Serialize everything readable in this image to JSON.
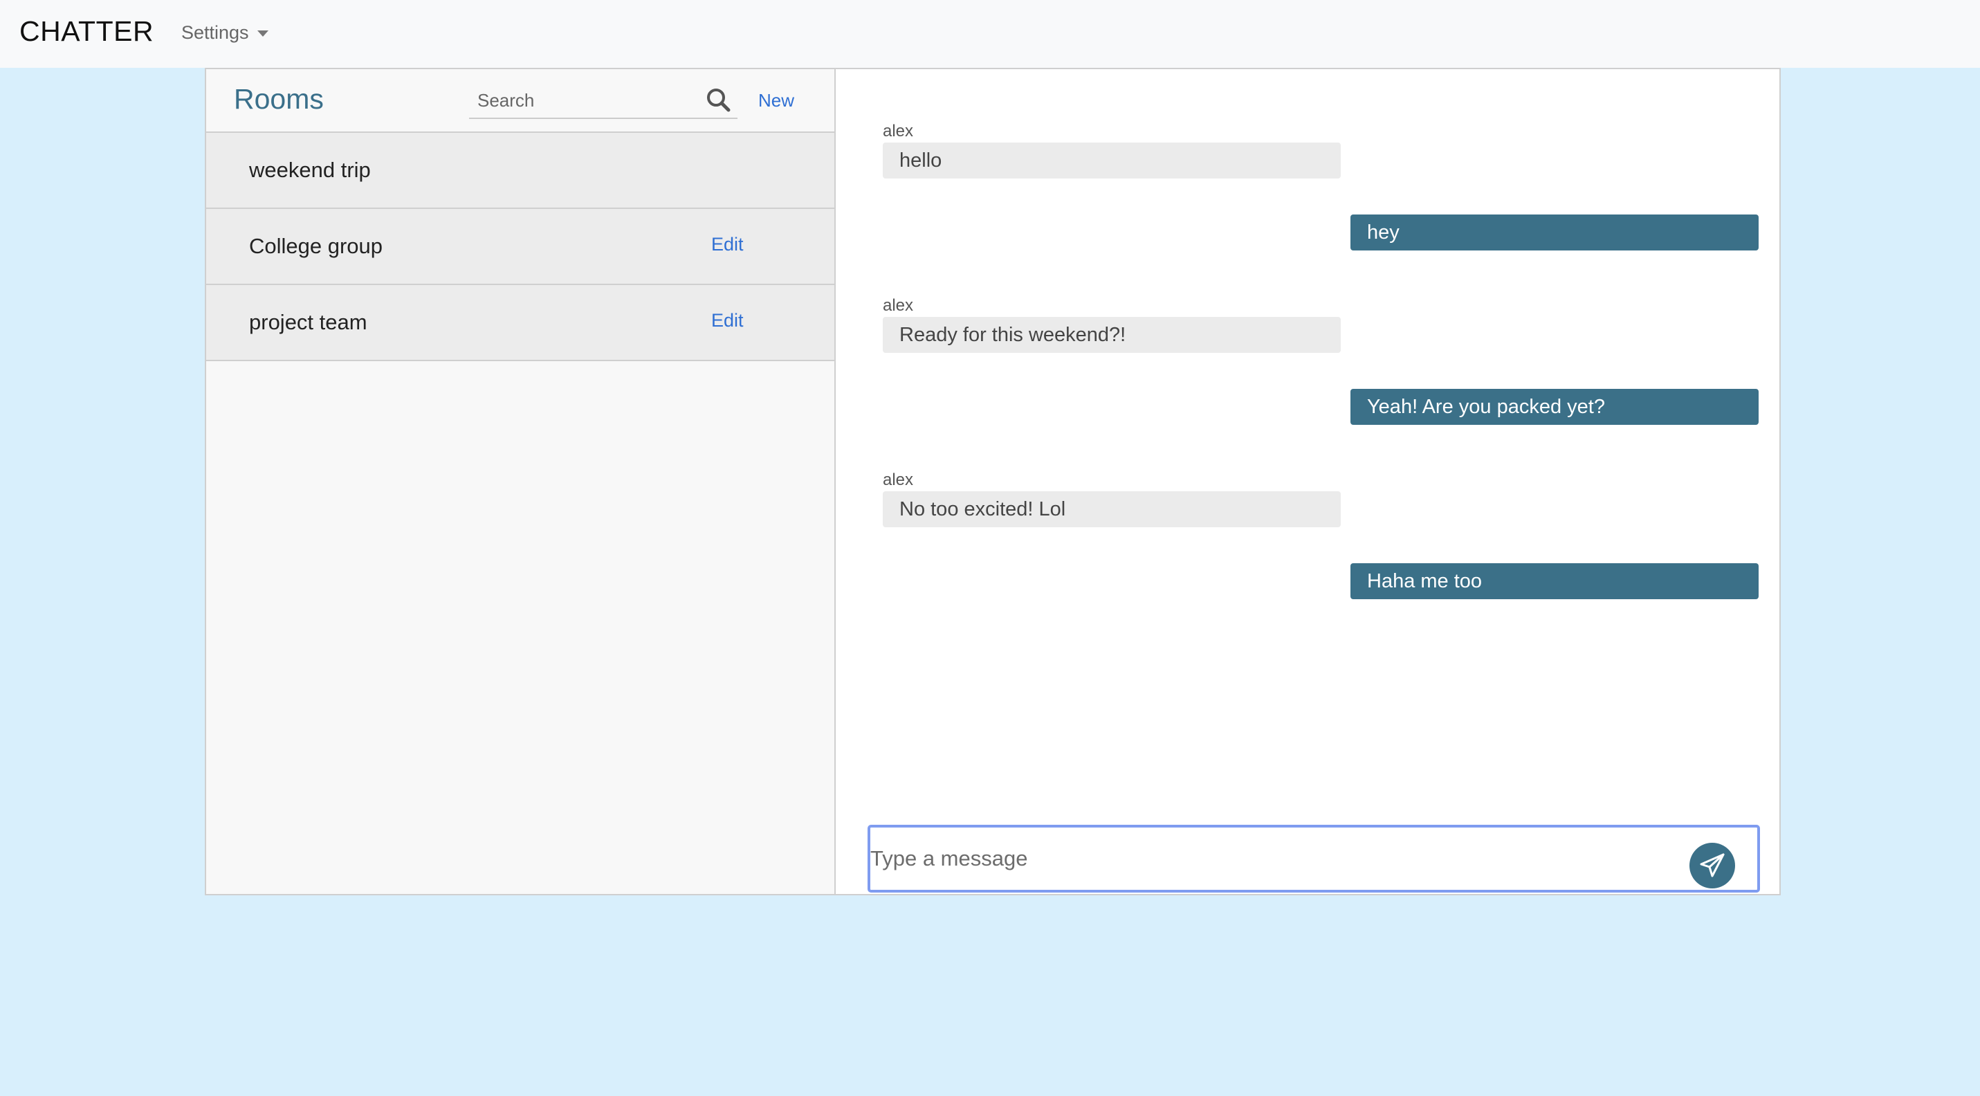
{
  "navbar": {
    "brand": "CHATTER",
    "settings_label": "Settings"
  },
  "sidebar": {
    "title": "Rooms",
    "search_placeholder": "Search",
    "new_label": "New",
    "rooms": [
      {
        "name": "weekend trip",
        "edit_label": ""
      },
      {
        "name": "College group",
        "edit_label": "Edit"
      },
      {
        "name": "project team",
        "edit_label": "Edit"
      }
    ]
  },
  "chat": {
    "messages": [
      {
        "sender": "alex",
        "text": "hello",
        "direction": "incoming"
      },
      {
        "sender": "",
        "text": "hey",
        "direction": "outgoing"
      },
      {
        "sender": "alex",
        "text": "Ready for this weekend?!",
        "direction": "incoming"
      },
      {
        "sender": "",
        "text": "Yeah! Are you packed yet?",
        "direction": "outgoing"
      },
      {
        "sender": "alex",
        "text": "No too excited! Lol",
        "direction": "incoming"
      },
      {
        "sender": "",
        "text": "Haha me too",
        "direction": "outgoing"
      }
    ],
    "input_placeholder": "Type a message",
    "send_icon": "paper-plane-icon"
  },
  "colors": {
    "background": "#d8effc",
    "navbar": "#f8f9fa",
    "accent": "#3b7088",
    "link": "#2f6fd3",
    "incoming_bubble": "#ebebeb",
    "focus_ring": "#7f9cf0"
  }
}
